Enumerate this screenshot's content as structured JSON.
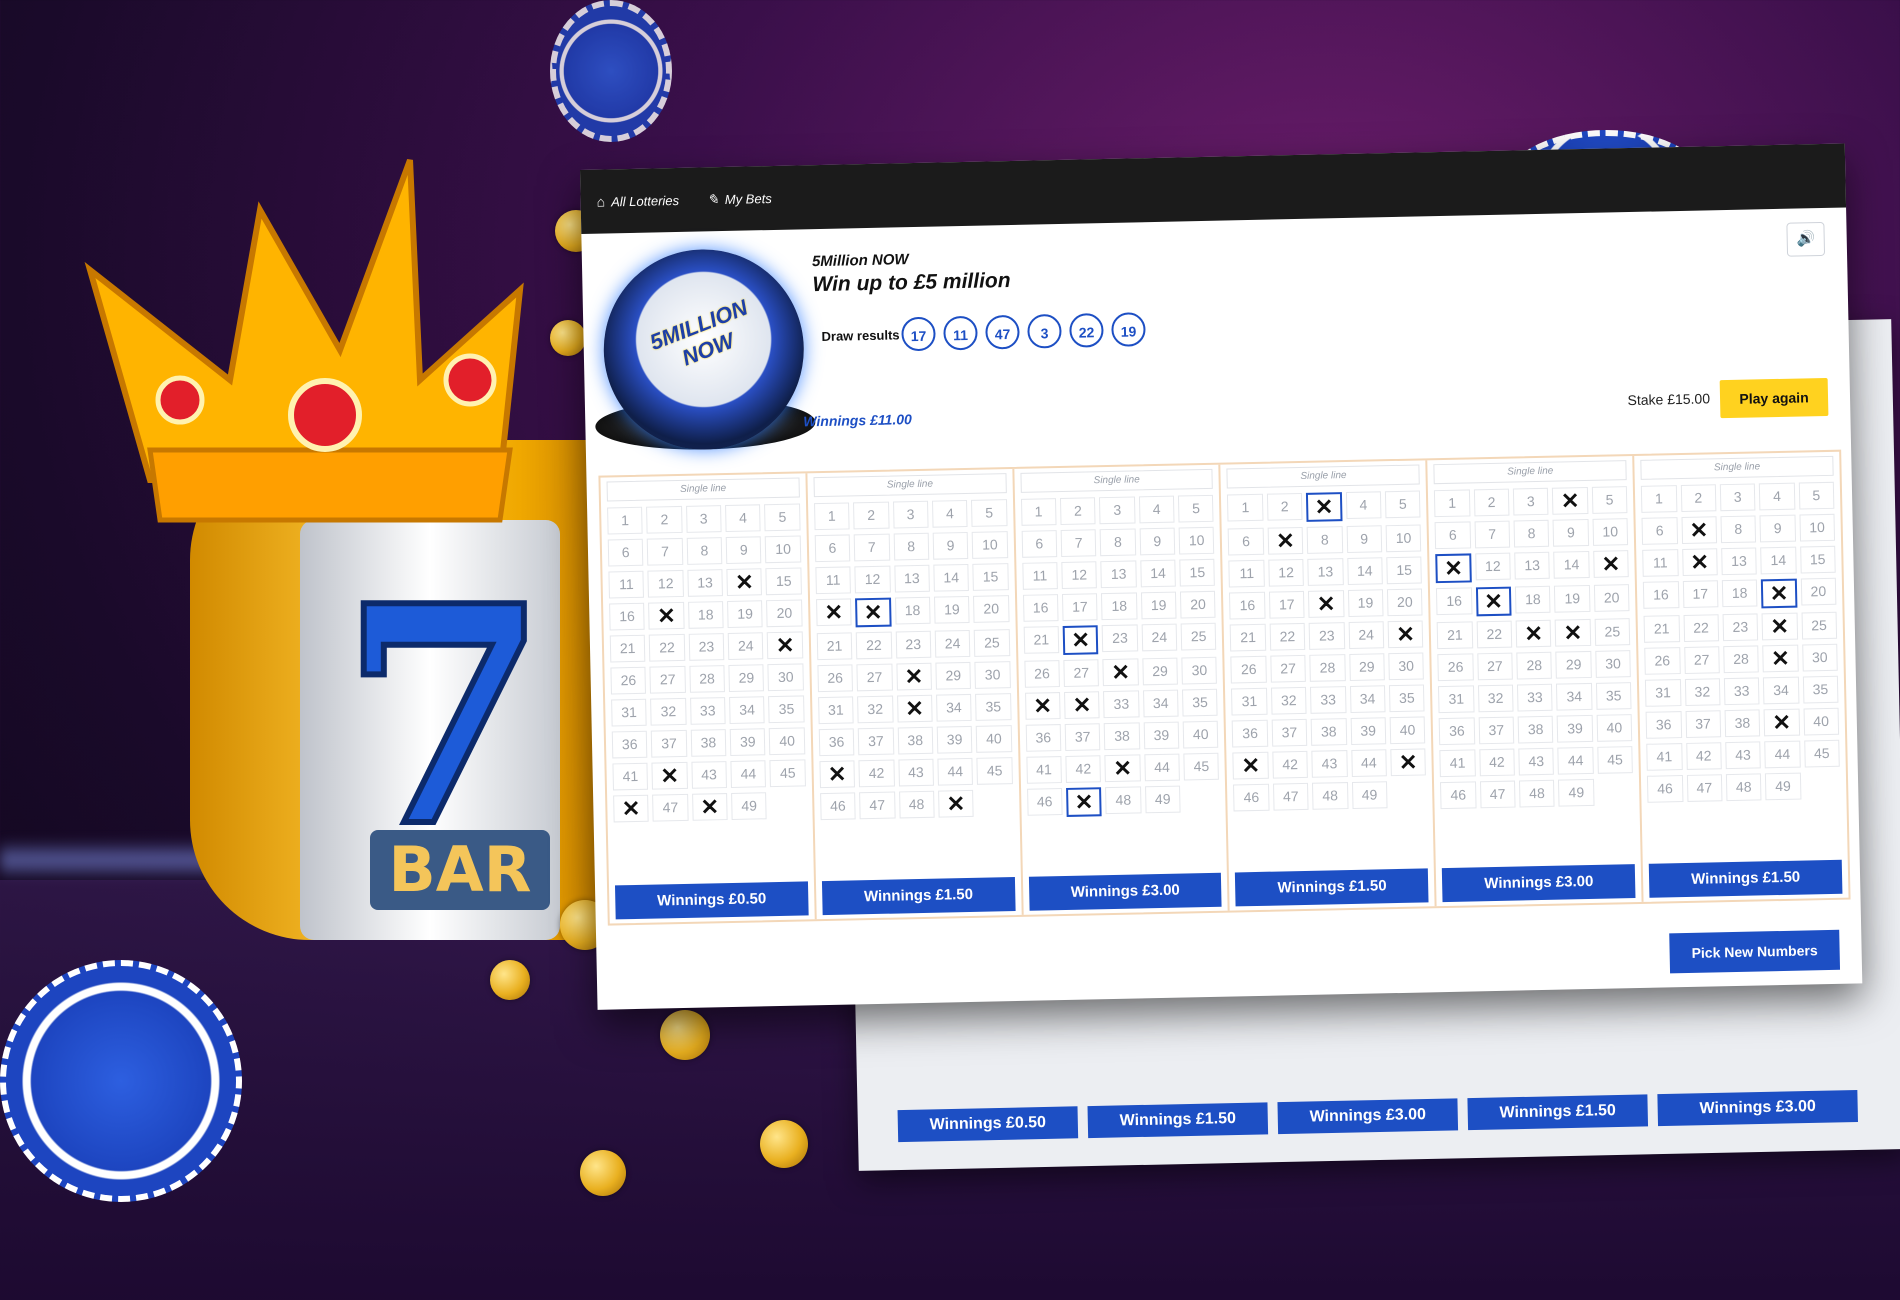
{
  "nav": {
    "all_lotteries": "All Lotteries",
    "my_bets": "My Bets"
  },
  "game": {
    "name": "5Million NOW",
    "subtitle": "Win up to £5 million",
    "logo_text": "5MILLION NOW",
    "draw_label": "Draw results",
    "draw_results": [
      "17",
      "11",
      "47",
      "3",
      "22",
      "19"
    ],
    "total_winnings": "Winnings £11.00",
    "stake": "Stake £15.00",
    "play_again": "Play again",
    "pick_new": "Pick New Numbers"
  },
  "art": {
    "bar_text": "BAR",
    "seven": "7"
  },
  "line_label": "Single line",
  "lines": [
    {
      "marked": [
        14,
        17,
        25,
        42,
        46,
        48
      ],
      "hits": [],
      "winnings": "Winnings £0.50"
    },
    {
      "marked": [
        16,
        17,
        28,
        33,
        41,
        49
      ],
      "hits": [
        17
      ],
      "winnings": "Winnings £1.50"
    },
    {
      "marked": [
        22,
        28,
        31,
        32,
        43,
        47
      ],
      "hits": [
        22,
        47
      ],
      "winnings": "Winnings £3.00"
    },
    {
      "marked": [
        3,
        7,
        18,
        25,
        41,
        45
      ],
      "hits": [
        3
      ],
      "winnings": "Winnings £1.50"
    },
    {
      "marked": [
        4,
        11,
        15,
        17,
        23,
        24
      ],
      "hits": [
        11,
        17
      ],
      "winnings": "Winnings £3.00"
    },
    {
      "marked": [
        7,
        12,
        19,
        24,
        29,
        39
      ],
      "hits": [
        19
      ],
      "winnings": "Winnings £1.50"
    }
  ],
  "ghost": {
    "winnings": [
      "Winnings £0.50",
      "Winnings £1.50",
      "Winnings £3.00",
      "Winnings £1.50",
      "Winnings £3.00"
    ]
  },
  "colors": {
    "accent_blue": "#1d4fc4",
    "play_yellow": "#ffd21f",
    "topbar": "#1b1b1b"
  }
}
